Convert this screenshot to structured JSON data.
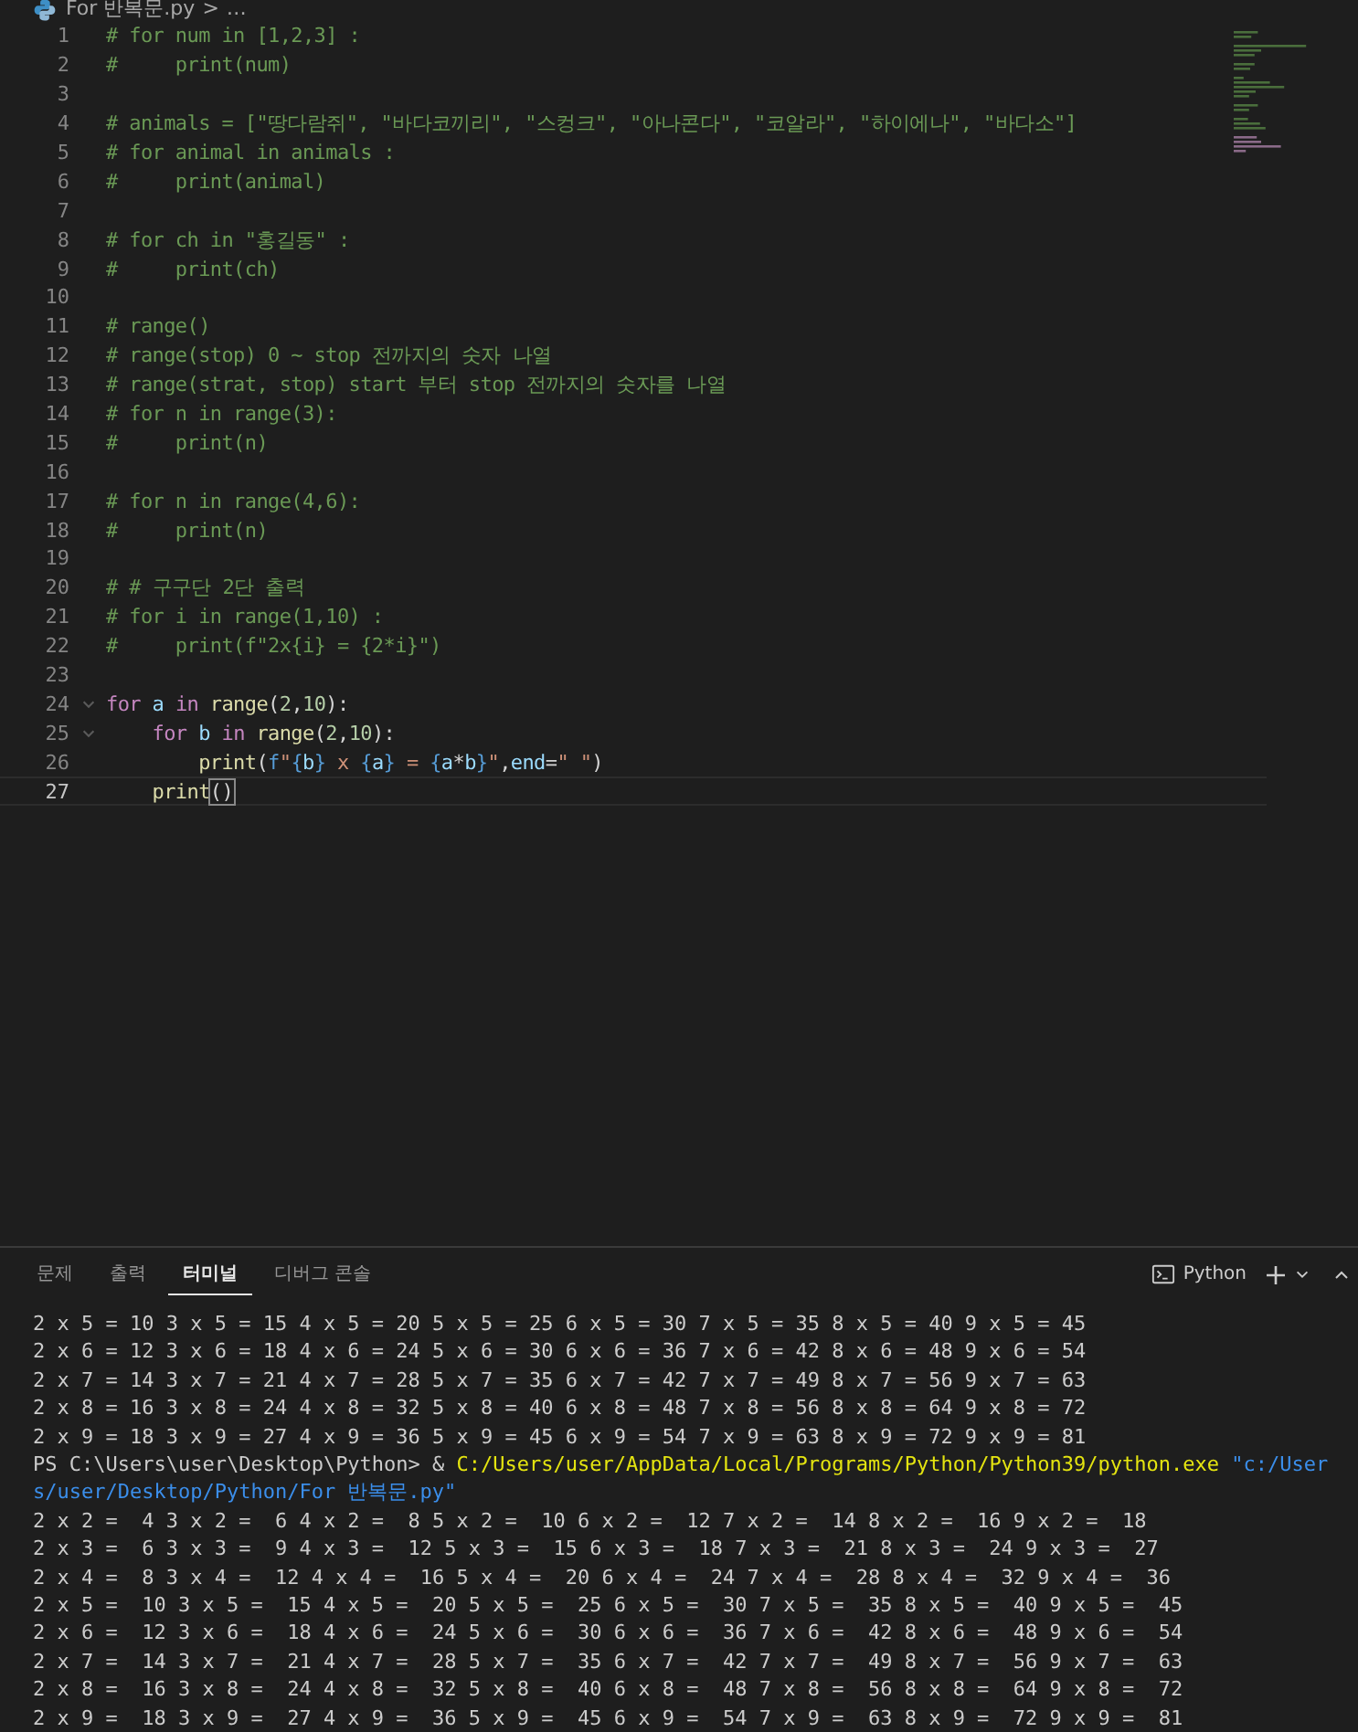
{
  "breadcrumb": {
    "file": "For 반복문.py",
    "separator": ">",
    "more": "…"
  },
  "editor": {
    "lines": [
      {
        "number": "1",
        "current": false,
        "tokens": [
          {
            "kind": "comment",
            "text": "# for num in [1,2,3] :"
          }
        ]
      },
      {
        "number": "2",
        "current": false,
        "tokens": [
          {
            "kind": "comment",
            "text": "#     print(num)"
          }
        ]
      },
      {
        "number": "3",
        "current": false
      },
      {
        "number": "4",
        "current": false,
        "tokens": [
          {
            "kind": "comment",
            "text": "# animals = [\"땅다람쥐\", \"바다코끼리\", \"스컹크\", \"아나콘다\", \"코알라\", \"하이에나\", \"바다소\"]"
          }
        ]
      },
      {
        "number": "5",
        "current": false,
        "tokens": [
          {
            "kind": "comment",
            "text": "# for animal in animals :"
          }
        ]
      },
      {
        "number": "6",
        "current": false,
        "tokens": [
          {
            "kind": "comment",
            "text": "#     print(animal)"
          }
        ]
      },
      {
        "number": "7",
        "current": false
      },
      {
        "number": "8",
        "current": false,
        "tokens": [
          {
            "kind": "comment",
            "text": "# for ch in \"홍길동\" :"
          }
        ]
      },
      {
        "number": "9",
        "current": false,
        "tokens": [
          {
            "kind": "comment",
            "text": "#     print(ch)"
          }
        ]
      },
      {
        "number": "10",
        "current": false
      },
      {
        "number": "11",
        "current": false,
        "tokens": [
          {
            "kind": "comment",
            "text": "# range()"
          }
        ]
      },
      {
        "number": "12",
        "current": false,
        "tokens": [
          {
            "kind": "comment",
            "text": "# range(stop) 0 ~ stop 전까지의 숫자 나열"
          }
        ]
      },
      {
        "number": "13",
        "current": false,
        "tokens": [
          {
            "kind": "comment",
            "text": "# range(strat, stop) start 부터 stop 전까지의 숫자를 나열"
          }
        ]
      },
      {
        "number": "14",
        "current": false,
        "tokens": [
          {
            "kind": "comment",
            "text": "# for n in range(3):"
          }
        ]
      },
      {
        "number": "15",
        "current": false,
        "tokens": [
          {
            "kind": "comment",
            "text": "#     print(n)"
          }
        ]
      },
      {
        "number": "16",
        "current": false
      },
      {
        "number": "17",
        "current": false,
        "tokens": [
          {
            "kind": "comment",
            "text": "# for n in range(4,6):"
          }
        ]
      },
      {
        "number": "18",
        "current": false,
        "tokens": [
          {
            "kind": "comment",
            "text": "#     print(n)"
          }
        ]
      },
      {
        "number": "19",
        "current": false
      },
      {
        "number": "20",
        "current": false,
        "tokens": [
          {
            "kind": "comment",
            "text": "# # 구구단 2단 출력"
          }
        ]
      },
      {
        "number": "21",
        "current": false,
        "tokens": [
          {
            "kind": "comment",
            "text": "# for i in range(1,10) :"
          }
        ]
      },
      {
        "number": "22",
        "current": false,
        "tokens": [
          {
            "kind": "comment",
            "text": "#     print(f\"2x{i} = {2*i}\")"
          }
        ]
      },
      {
        "number": "23",
        "current": false
      },
      {
        "number": "24",
        "current": false,
        "fold": true,
        "tokens": [
          {
            "kind": "keyword",
            "text": "for"
          },
          {
            "kind": "variable",
            "text": " a"
          },
          {
            "kind": "keyword",
            "text": " in"
          },
          {
            "kind": "function",
            "text": " range"
          },
          {
            "kind": "plain",
            "text": "("
          },
          {
            "kind": "number",
            "text": "2"
          },
          {
            "kind": "plain",
            "text": ","
          },
          {
            "kind": "number",
            "text": "10"
          },
          {
            "kind": "plain",
            "text": "):"
          }
        ]
      },
      {
        "number": "25",
        "current": false,
        "fold": true,
        "tokens": [
          {
            "kind": "keyword",
            "text": "    for"
          },
          {
            "kind": "variable",
            "text": " b"
          },
          {
            "kind": "keyword",
            "text": " in"
          },
          {
            "kind": "function",
            "text": " range"
          },
          {
            "kind": "plain",
            "text": "("
          },
          {
            "kind": "number",
            "text": "2"
          },
          {
            "kind": "plain",
            "text": ","
          },
          {
            "kind": "number",
            "text": "10"
          },
          {
            "kind": "plain",
            "text": "):"
          }
        ]
      },
      {
        "number": "26",
        "current": false,
        "tokens": [
          {
            "kind": "function",
            "text": "        print"
          },
          {
            "kind": "plain",
            "text": "("
          },
          {
            "kind": "storage",
            "text": "f"
          },
          {
            "kind": "string",
            "text": "\""
          },
          {
            "kind": "storage",
            "text": "{"
          },
          {
            "kind": "variable",
            "text": "b"
          },
          {
            "kind": "storage",
            "text": "}"
          },
          {
            "kind": "string",
            "text": " x "
          },
          {
            "kind": "storage",
            "text": "{"
          },
          {
            "kind": "variable",
            "text": "a"
          },
          {
            "kind": "storage",
            "text": "}"
          },
          {
            "kind": "string",
            "text": " = "
          },
          {
            "kind": "storage",
            "text": "{"
          },
          {
            "kind": "variable",
            "text": "a"
          },
          {
            "kind": "operator",
            "text": "*"
          },
          {
            "kind": "variable",
            "text": "b"
          },
          {
            "kind": "storage",
            "text": "}"
          },
          {
            "kind": "string",
            "text": "\""
          },
          {
            "kind": "plain",
            "text": ","
          },
          {
            "kind": "variable",
            "text": "end"
          },
          {
            "kind": "operator",
            "text": "="
          },
          {
            "kind": "string",
            "text": "\" \""
          },
          {
            "kind": "plain",
            "text": ")"
          }
        ]
      },
      {
        "number": "27",
        "current": true,
        "tokens": [
          {
            "kind": "function",
            "text": "    print"
          },
          {
            "kind": "bracket",
            "text": "()"
          }
        ]
      }
    ]
  },
  "panel": {
    "tabs": [
      {
        "label": "문제",
        "selected": false
      },
      {
        "label": "출력",
        "selected": false
      },
      {
        "label": "터미널",
        "selected": true
      },
      {
        "label": "디버그 콘솔",
        "selected": false
      }
    ],
    "terminal_name": "Python",
    "terminal": [
      {
        "kind": "output",
        "text": "2 x 5 = 10 3 x 5 = 15 4 x 5 = 20 5 x 5 = 25 6 x 5 = 30 7 x 5 = 35 8 x 5 = 40 9 x 5 = 45"
      },
      {
        "kind": "output",
        "text": "2 x 6 = 12 3 x 6 = 18 4 x 6 = 24 5 x 6 = 30 6 x 6 = 36 7 x 6 = 42 8 x 6 = 48 9 x 6 = 54"
      },
      {
        "kind": "output",
        "text": "2 x 7 = 14 3 x 7 = 21 4 x 7 = 28 5 x 7 = 35 6 x 7 = 42 7 x 7 = 49 8 x 7 = 56 9 x 7 = 63"
      },
      {
        "kind": "output",
        "text": "2 x 8 = 16 3 x 8 = 24 4 x 8 = 32 5 x 8 = 40 6 x 8 = 48 7 x 8 = 56 8 x 8 = 64 9 x 8 = 72"
      },
      {
        "kind": "output",
        "text": "2 x 9 = 18 3 x 9 = 27 4 x 9 = 36 5 x 9 = 45 6 x 9 = 54 7 x 9 = 63 8 x 9 = 72 9 x 9 = 81"
      },
      {
        "kind": "command",
        "prompt": "PS C:\\Users\\user\\Desktop\\Python> &",
        "executable": "C:/Users/user/AppData/Local/Programs/Python/Python39/python.exe",
        "argument": "\"c:/Users/user/Desktop/Python/For 반복문.py\""
      },
      {
        "kind": "output",
        "text": "2 x 2 =  4 3 x 2 =  6 4 x 2 =  8 5 x 2 =  10 6 x 2 =  12 7 x 2 =  14 8 x 2 =  16 9 x 2 =  18"
      },
      {
        "kind": "output",
        "text": "2 x 3 =  6 3 x 3 =  9 4 x 3 =  12 5 x 3 =  15 6 x 3 =  18 7 x 3 =  21 8 x 3 =  24 9 x 3 =  27"
      },
      {
        "kind": "output",
        "text": "2 x 4 =  8 3 x 4 =  12 4 x 4 =  16 5 x 4 =  20 6 x 4 =  24 7 x 4 =  28 8 x 4 =  32 9 x 4 =  36"
      },
      {
        "kind": "output",
        "text": "2 x 5 =  10 3 x 5 =  15 4 x 5 =  20 5 x 5 =  25 6 x 5 =  30 7 x 5 =  35 8 x 5 =  40 9 x 5 =  45"
      },
      {
        "kind": "output",
        "text": "2 x 6 =  12 3 x 6 =  18 4 x 6 =  24 5 x 6 =  30 6 x 6 =  36 7 x 6 =  42 8 x 6 =  48 9 x 6 =  54"
      },
      {
        "kind": "output",
        "text": "2 x 7 =  14 3 x 7 =  21 4 x 7 =  28 5 x 7 =  35 6 x 7 =  42 7 x 7 =  49 8 x 7 =  56 9 x 7 =  63"
      },
      {
        "kind": "output",
        "text": "2 x 8 =  16 3 x 8 =  24 4 x 8 =  32 5 x 8 =  40 6 x 8 =  48 7 x 8 =  56 8 x 8 =  64 9 x 8 =  72"
      },
      {
        "kind": "output",
        "text": "2 x 9 =  18 3 x 9 =  27 4 x 9 =  36 5 x 9 =  45 6 x 9 =  54 7 x 9 =  63 8 x 9 =  72 9 x 9 =  81"
      }
    ]
  }
}
